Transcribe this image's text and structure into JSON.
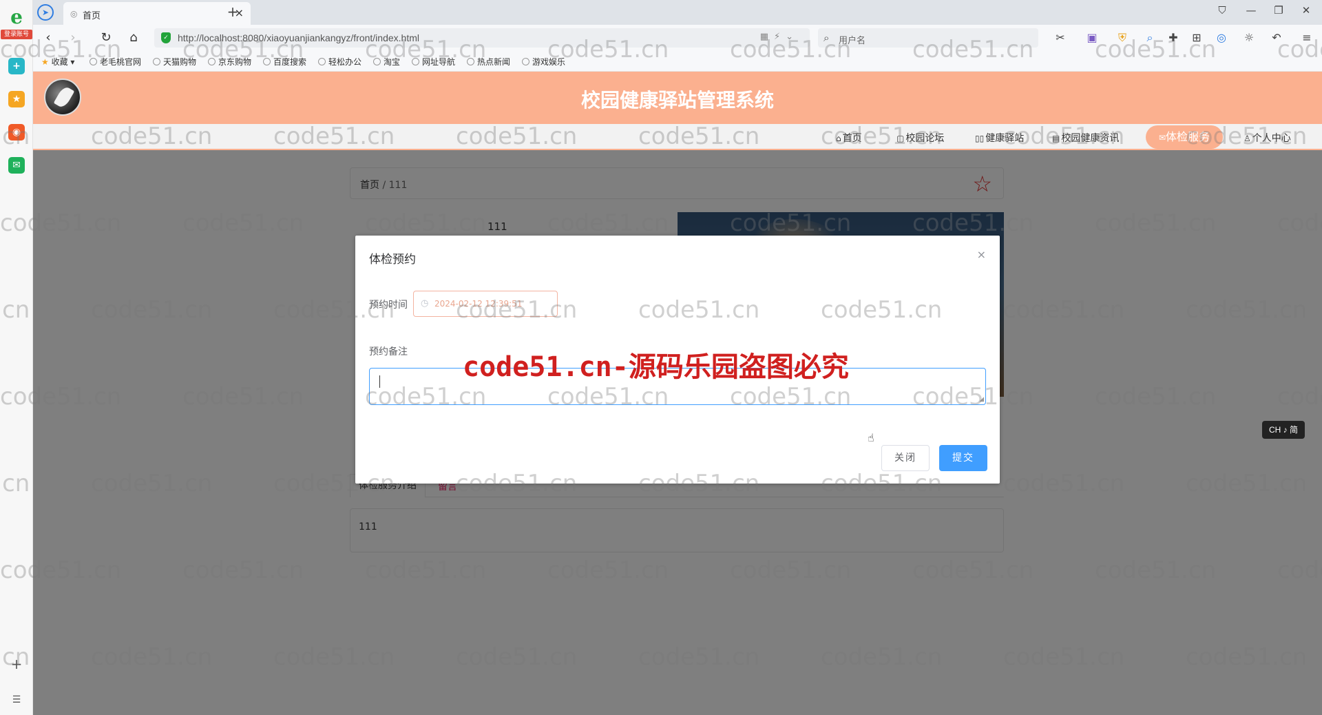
{
  "browser": {
    "tab_title": "首页",
    "login_badge": "登录账号",
    "url": "http://localhost:8080/xiaoyuanjiankangyz/front/index.html",
    "search_placeholder": "用户名",
    "bookmarks": [
      "收藏",
      "老毛桃官网",
      "天猫购物",
      "京东购物",
      "百度搜索",
      "轻松办公",
      "淘宝",
      "网址导航",
      "热点新闻",
      "游戏娱乐"
    ]
  },
  "site": {
    "title": "校园健康驿站管理系统",
    "nav": [
      "首页",
      "校园论坛",
      "健康驿站",
      "校园健康资讯",
      "体检服务",
      "个人中心"
    ],
    "active_nav": "体检服务"
  },
  "page": {
    "breadcrumb_home": "首页",
    "breadcrumb_sep": "/",
    "breadcrumb_current": "111",
    "item_name": "111",
    "tab_intro": "体检服务介绍",
    "tab_comment": "留言",
    "intro_text": "111"
  },
  "dialog": {
    "title": "体检预约",
    "close_icon": "×",
    "time_label": "预约时间",
    "time_value": "2024-02-12 12:39:51",
    "remark_label": "预约备注",
    "remark_value": "",
    "btn_close": "关闭",
    "btn_submit": "提交"
  },
  "ime": "CH ♪ 简",
  "watermark": {
    "text": "code51.cn",
    "center_text": "code51.cn-源码乐园盗图必究"
  },
  "colors": {
    "header": "#fbb08f",
    "primary": "#409eff",
    "watermark_red": "#d0201f"
  }
}
